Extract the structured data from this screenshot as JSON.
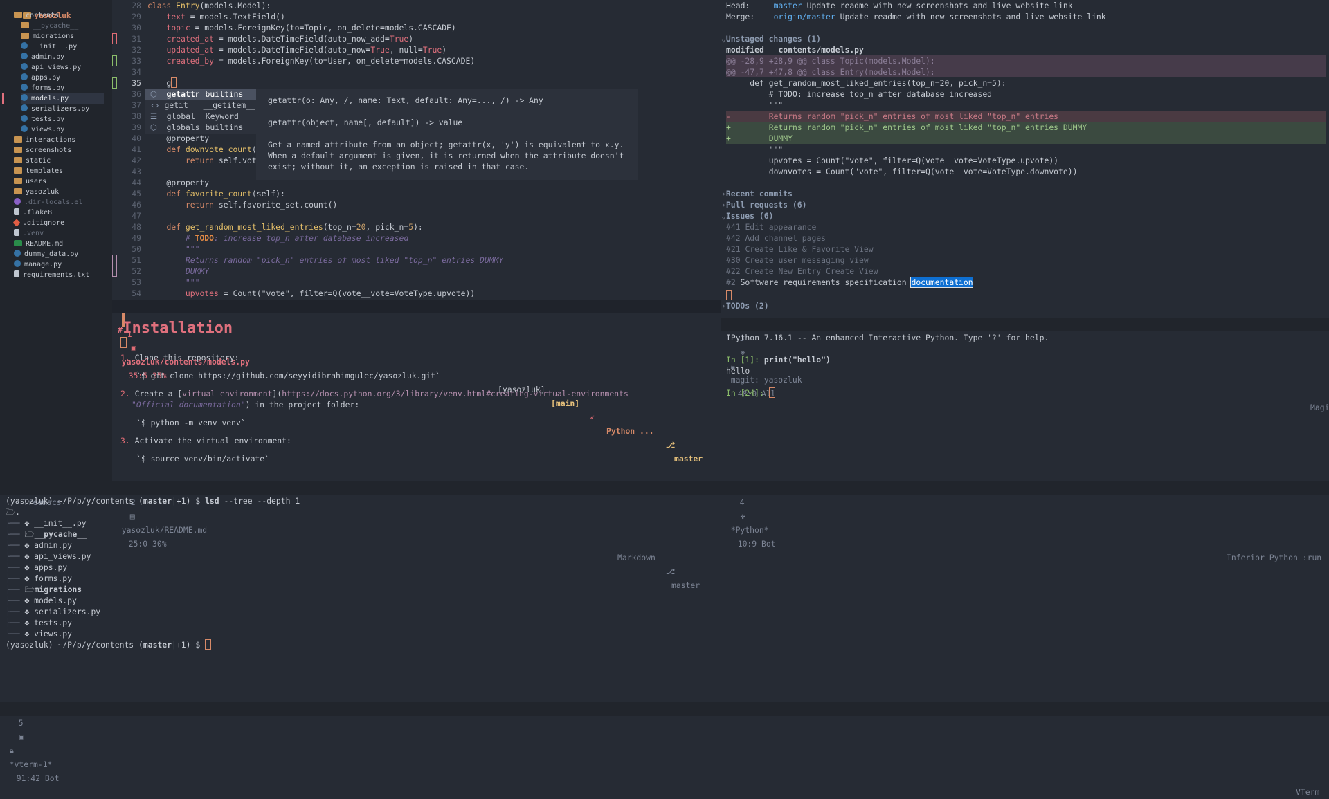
{
  "treemacs": {
    "root": "yasozluk",
    "items": [
      {
        "label": "contents",
        "icon": "folder-open-icon",
        "indent": 1,
        "kind": "folder"
      },
      {
        "label": "__pycache__",
        "icon": "folder-icon",
        "indent": 2,
        "kind": "folder",
        "dim": true
      },
      {
        "label": "migrations",
        "icon": "folder-icon",
        "indent": 2,
        "kind": "folder"
      },
      {
        "label": "__init__.py",
        "icon": "python-icon",
        "indent": 2,
        "kind": "py"
      },
      {
        "label": "admin.py",
        "icon": "python-icon",
        "indent": 2,
        "kind": "py"
      },
      {
        "label": "api_views.py",
        "icon": "python-icon",
        "indent": 2,
        "kind": "py"
      },
      {
        "label": "apps.py",
        "icon": "python-icon",
        "indent": 2,
        "kind": "py"
      },
      {
        "label": "forms.py",
        "icon": "python-icon",
        "indent": 2,
        "kind": "py"
      },
      {
        "label": "models.py",
        "icon": "python-icon",
        "indent": 2,
        "kind": "py",
        "selected": true
      },
      {
        "label": "serializers.py",
        "icon": "python-icon",
        "indent": 2,
        "kind": "py"
      },
      {
        "label": "tests.py",
        "icon": "python-icon",
        "indent": 2,
        "kind": "py"
      },
      {
        "label": "views.py",
        "icon": "python-icon",
        "indent": 2,
        "kind": "py"
      },
      {
        "label": "interactions",
        "icon": "folder-icon",
        "indent": 1,
        "kind": "folder"
      },
      {
        "label": "screenshots",
        "icon": "folder-icon",
        "indent": 1,
        "kind": "folder"
      },
      {
        "label": "static",
        "icon": "folder-icon",
        "indent": 1,
        "kind": "folder"
      },
      {
        "label": "templates",
        "icon": "folder-icon",
        "indent": 1,
        "kind": "folder"
      },
      {
        "label": "users",
        "icon": "folder-icon",
        "indent": 1,
        "kind": "folder"
      },
      {
        "label": "yasozluk",
        "icon": "folder-icon",
        "indent": 1,
        "kind": "folder"
      },
      {
        "label": ".dir-locals.el",
        "icon": "emacs-lisp-icon",
        "indent": 1,
        "kind": "el",
        "dim": true
      },
      {
        "label": ".flake8",
        "icon": "file-icon",
        "indent": 1,
        "kind": "file"
      },
      {
        "label": ".gitignore",
        "icon": "git-icon",
        "indent": 1,
        "kind": "git"
      },
      {
        "label": ".venv",
        "icon": "file-icon",
        "indent": 1,
        "kind": "file",
        "dim": true
      },
      {
        "label": "README.md",
        "icon": "markdown-icon",
        "indent": 1,
        "kind": "md"
      },
      {
        "label": "dummy_data.py",
        "icon": "python-icon",
        "indent": 1,
        "kind": "py"
      },
      {
        "label": "manage.py",
        "icon": "python-icon",
        "indent": 1,
        "kind": "py"
      },
      {
        "label": "requirements.txt",
        "icon": "file-icon",
        "indent": 1,
        "kind": "file"
      }
    ],
    "modeline": "Treemacs"
  },
  "editor": {
    "lines": [
      {
        "n": "28",
        "html": "<span class='kw'>class</span> <span class='cls'>Entry</span>(models.Model):"
      },
      {
        "n": "29",
        "html": "    <span class='attr'>text</span> = models.TextField()"
      },
      {
        "n": "30",
        "html": "    <span class='attr'>topic</span> = models.ForeignKey(to=Topic, on_delete=models.CASCADE)"
      },
      {
        "n": "31",
        "html": "    <span class='attr'>created_at</span> = models.DateTimeField(auto_now_add=<span class='true'>True</span>)"
      },
      {
        "n": "32",
        "html": "    <span class='attr'>updated_at</span> = models.DateTimeField(auto_now=<span class='true'>True</span>, null=<span class='true'>True</span>)"
      },
      {
        "n": "33",
        "html": "    <span class='attr'>created_by</span> = models.ForeignKey(to=User, on_delete=models.CASCADE)"
      },
      {
        "n": "34",
        "html": ""
      },
      {
        "n": "35",
        "html": "    g<span class='cursor-box' style='width:6px'></span>",
        "current": true
      },
      {
        "n": "36",
        "html": ""
      },
      {
        "n": "37",
        "html": ""
      },
      {
        "n": "38",
        "html": ""
      },
      {
        "n": "39",
        "html": ""
      },
      {
        "n": "40",
        "html": "    @property"
      },
      {
        "n": "41",
        "html": "    <span class='kw'>def</span> <span class='fn'>downvote_count</span>(se"
      },
      {
        "n": "42",
        "html": "        <span class='kw'>return</span> self.vote_"
      },
      {
        "n": "43",
        "html": ""
      },
      {
        "n": "44",
        "html": "    @property"
      },
      {
        "n": "45",
        "html": "    <span class='kw'>def</span> <span class='fn'>favorite_count</span>(self):"
      },
      {
        "n": "46",
        "html": "        <span class='kw'>return</span> self.favorite_set.count()"
      },
      {
        "n": "47",
        "html": ""
      },
      {
        "n": "48",
        "html": "    <span class='kw'>def</span> <span class='fn'>get_random_most_liked_entries</span>(top_n=<span class='num'>20</span>, pick_n=<span class='num'>5</span>):"
      },
      {
        "n": "49",
        "html": "        <span class='cmt'># <span class='todo'>TODO</span>: increase top_n after database increased</span>"
      },
      {
        "n": "50",
        "html": "        <span class='cmt'>\"\"\"</span>"
      },
      {
        "n": "51",
        "html": "        <span class='cmt'>Returns random \"pick_n\" entries of most liked \"top_n\" entries DUMMY</span>"
      },
      {
        "n": "52",
        "html": "        <span class='cmt'>DUMMY</span>"
      },
      {
        "n": "53",
        "html": "        <span class='cmt'>\"\"\"</span>"
      },
      {
        "n": "54",
        "html": "        <span class='attr'>upvotes</span> = Count(<span class='str'>\"vote\"</span>, filter=Q(vote__vote=VoteType.upvote))"
      }
    ],
    "popup": [
      {
        "name": "getattr",
        "source": "builtins",
        "selected": true
      },
      {
        "name": "getit",
        "source": "__getitem__"
      },
      {
        "name": "global",
        "source": "Keyword"
      },
      {
        "name": "globals",
        "source": "builtins"
      }
    ],
    "doc": {
      "sig1": "getattr(o: Any, /, name: Text, default: Any=..., /) -> Any",
      "sig2": "getattr(object, name[, default]) -> value",
      "body1": "Get a named attribute from an object; getattr(x, 'y') is equivalent to x.y.",
      "body2": "When a default argument is given, it is returned when the attribute doesn't",
      "body3": "exist; without it, an exception is raised in that case."
    },
    "modeline": {
      "num": "1",
      "file": "yasozluk/contents/models.py",
      "pos": "35:5 35%",
      "project": "[yasozluk]",
      "branch_tag": "[main]",
      "mode": "Python ...",
      "vcs": "master"
    }
  },
  "readme": {
    "heading": "Installation",
    "step1": "1. Clone this repository:",
    "cmd1": "`$ git clone https://github.com/seyyidibrahimgulec/yasozluk.git`",
    "step2a": "2. Create a [virtual environment](https://docs.python.org/3/library/venv.html#creating-virtual-environments",
    "step2_link_text": "virtual environment",
    "step2_url": "https://docs.python.org/3/library/venv.html#creating-virtual-environments",
    "step2b_title": "\"Official documentation\"",
    "step2b_rest": ") in the project folder:",
    "cmd2": "`$ python -m venv venv`",
    "step3": "3. Activate the virtual environment:",
    "cmd3": "`$ source venv/bin/activate`",
    "modeline": {
      "num": "2",
      "file": "yasozluk/README.md",
      "pos": "25:0 30%",
      "mode": "Markdown",
      "vcs": "master"
    }
  },
  "magit": {
    "head_label": "Head:",
    "head_branch": "master",
    "head_msg": "Update readme with new screenshots and live website link",
    "merge_label": "Merge:",
    "merge_branch": "origin/master",
    "merge_msg": "Update readme with new screenshots and live website link",
    "unstaged": "Unstaged changes (1)",
    "modified_label": "modified",
    "modified_file": "contents/models.py",
    "hunk1": "@@ -28,9 +28,9 @@ class Topic(models.Model):",
    "hunk2": "@@ -47,7 +47,8 @@ class Entry(models.Model):",
    "ctx1": "     def get_random_most_liked_entries(top_n=20, pick_n=5):",
    "ctx2": "         # TODO: increase top_n after database increased",
    "ctx3": "         \"\"\"",
    "del1": "-        Returns random \"pick_n\" entries of most liked \"top_n\" entries",
    "add1": "+        Returns random \"pick_n\" entries of most liked \"top_n\" entries DUMMY",
    "add2": "+        DUMMY",
    "ctx4": "         \"\"\"",
    "ctx5": "         upvotes = Count(\"vote\", filter=Q(vote__vote=VoteType.upvote))",
    "ctx6": "         downvotes = Count(\"vote\", filter=Q(vote__vote=VoteType.downvote))",
    "recent": "Recent commits",
    "pulls": "Pull requests (6)",
    "issues": "Issues (6)",
    "issue_list": [
      {
        "num": "#41",
        "title": "Edit appearance"
      },
      {
        "num": "#42",
        "title": "Add channel pages"
      },
      {
        "num": "#21",
        "title": "Create Like & Favorite View"
      },
      {
        "num": "#30",
        "title": "Create user messaging view"
      },
      {
        "num": "#22",
        "title": "Create New Entry Create View"
      }
    ],
    "issue_last_num": "#2",
    "issue_last_title": " Software requirements specification ",
    "issue_last_hl": "documentation",
    "todos": "TODOs (2)",
    "modeline": {
      "num": "3",
      "name": "magit: yasozluk",
      "pos": "48:0 All",
      "mode": "Magit"
    }
  },
  "ipython": {
    "banner": "IPython 7.16.1 -- An enhanced Interactive Python. Type '?' for help.",
    "in1": "In [1]: ",
    "cmd1": "print(\"hello\")",
    "out1": "hello",
    "in2": "In [24]: ",
    "modeline": {
      "num": "4",
      "name": "*Python*",
      "pos": "10:9 Bot",
      "mode": "Inferior Python :run"
    }
  },
  "terminal": {
    "prompt_pre": "(yasozluk) ~/P/p/y/contents (",
    "prompt_branch": "master",
    "prompt_post": "|+1) $ ",
    "cmd_bin": "lsd",
    "cmd_args": " --tree --depth 1",
    "tree_root": ".",
    "tree": [
      {
        "label": "__init__.py",
        "dir": false
      },
      {
        "label": "__pycache__",
        "dir": true
      },
      {
        "label": "admin.py",
        "dir": false
      },
      {
        "label": "api_views.py",
        "dir": false
      },
      {
        "label": "apps.py",
        "dir": false
      },
      {
        "label": "forms.py",
        "dir": false
      },
      {
        "label": "migrations",
        "dir": true
      },
      {
        "label": "models.py",
        "dir": false
      },
      {
        "label": "serializers.py",
        "dir": false
      },
      {
        "label": "tests.py",
        "dir": false
      },
      {
        "label": "views.py",
        "dir": false
      }
    ],
    "modeline": {
      "num": "5",
      "name": "*vterm-1*",
      "pos": "91:42 Bot",
      "mode": "VTerm"
    }
  }
}
